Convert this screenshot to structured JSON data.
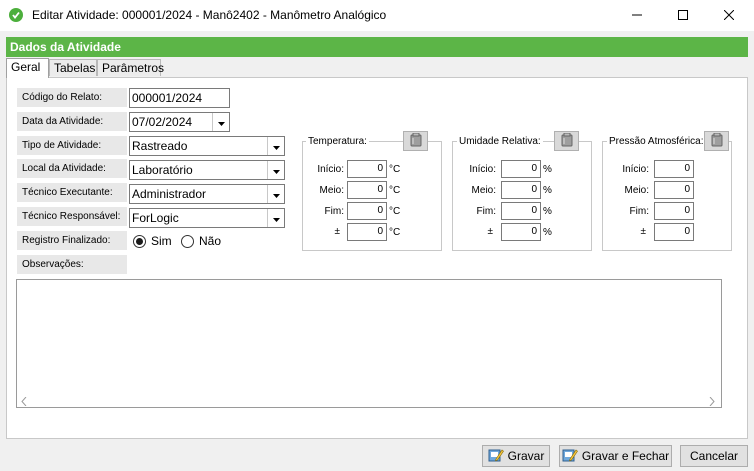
{
  "window": {
    "title": "Editar Atividade: 000001/2024 - Manô2402 - Manômetro Analógico"
  },
  "header": {
    "title": "Dados da Atividade"
  },
  "tabs": [
    {
      "label": "Geral"
    },
    {
      "label": "Tabelas"
    },
    {
      "label": "Parâmetros"
    }
  ],
  "form": {
    "codigo_label": "Código do Relato:",
    "codigo_value": "000001/2024",
    "data_label": "Data da Atividade:",
    "data_value": "07/02/2024",
    "tipo_label": "Tipo de Atividade:",
    "tipo_value": "Rastreado",
    "local_label": "Local da Atividade:",
    "local_value": "Laboratório",
    "tecnico_exec_label": "Técnico Executante:",
    "tecnico_exec_value": "Administrador",
    "tecnico_resp_label": "Técnico Responsável:",
    "tecnico_resp_value": "ForLogic",
    "registro_label": "Registro Finalizado:",
    "sim_label": "Sim",
    "nao_label": "Não",
    "obs_label": "Observações:"
  },
  "groups": {
    "temperatura": {
      "title": "Temperatura:",
      "unit": "°C"
    },
    "umidade": {
      "title": "Umidade Relativa:",
      "unit": "%"
    },
    "pressao": {
      "title": "Pressão Atmosférica:",
      "unit": ""
    }
  },
  "rows": {
    "inicio": "Início:",
    "meio": "Meio:",
    "fim": "Fim:",
    "pm": "±"
  },
  "values": {
    "zero": "0"
  },
  "buttons": {
    "gravar": "Gravar",
    "gravar_fechar": "Gravar e Fechar",
    "cancelar": "Cancelar"
  },
  "colors": {
    "accent": "#5cb547"
  }
}
